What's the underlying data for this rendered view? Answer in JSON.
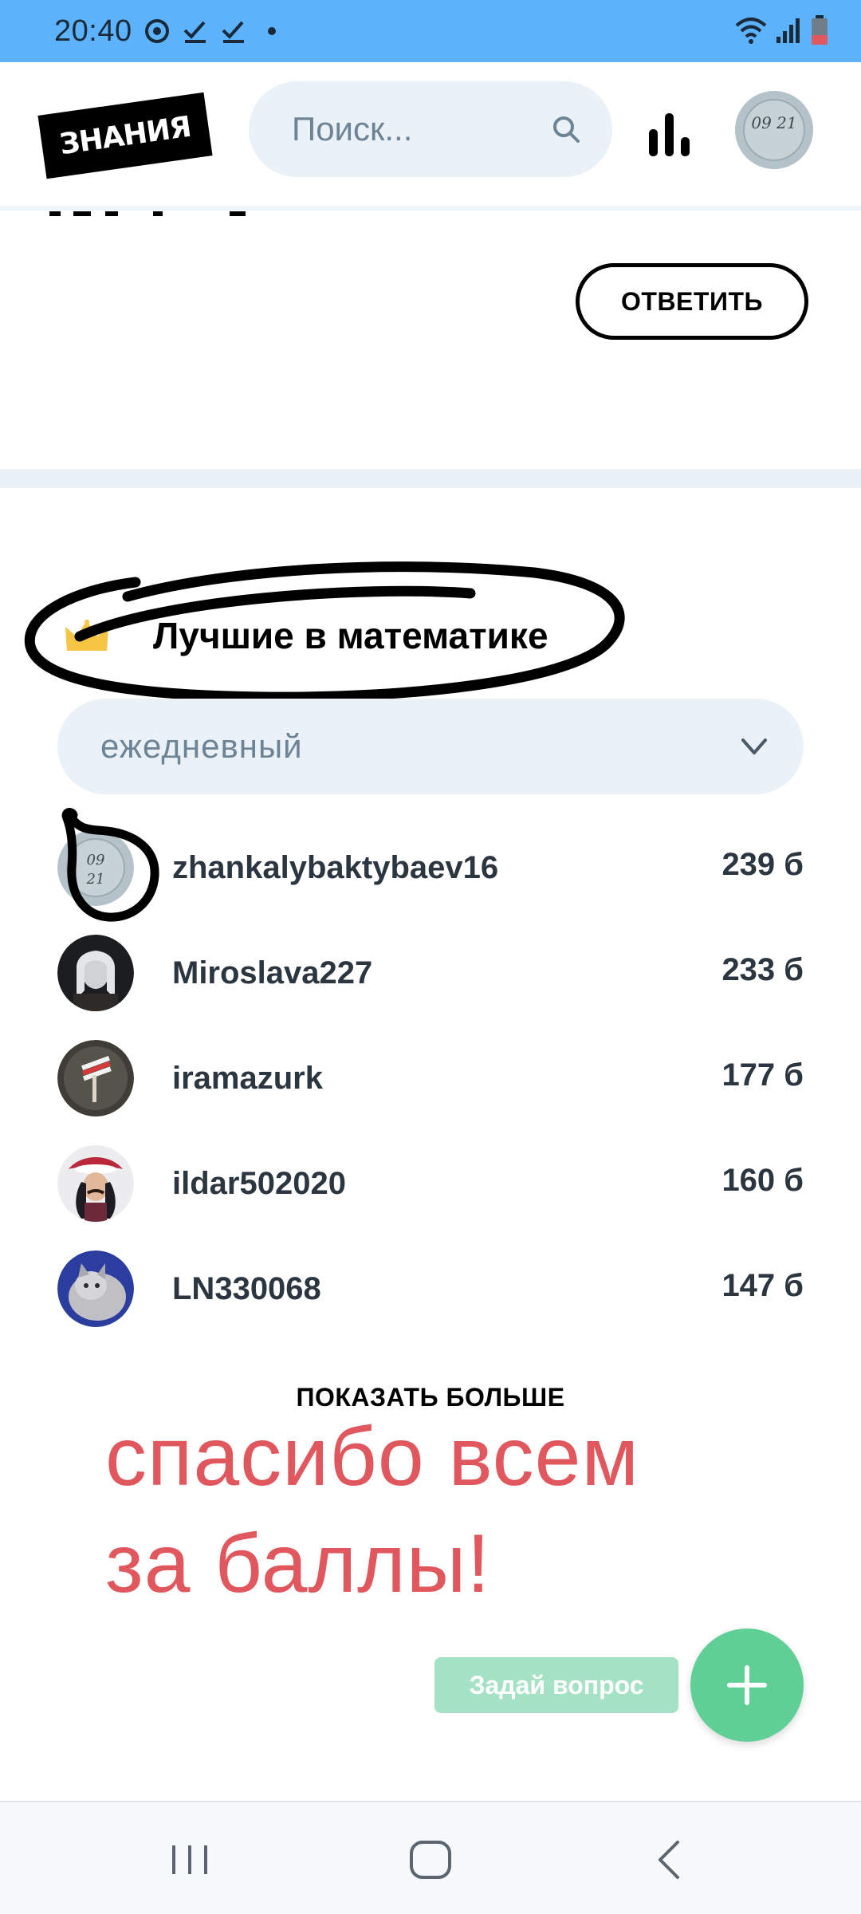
{
  "status_bar": {
    "time": "20:40"
  },
  "header": {
    "logo": "ЗНАНИЯ",
    "search_placeholder": "Поиск...",
    "avatar_text": "09 21"
  },
  "answer": {
    "button_label": "ОТВЕТИТЬ"
  },
  "leaders": {
    "title": "Лучшие в математике",
    "period": "ежедневный",
    "items": [
      {
        "name": "zhankalybaktybaev16",
        "points": "239 б"
      },
      {
        "name": "Miroslava227",
        "points": "233 б"
      },
      {
        "name": "iramazurk",
        "points": "177 б"
      },
      {
        "name": "ildar502020",
        "points": "160 б"
      },
      {
        "name": "LN330068",
        "points": "147 б"
      }
    ],
    "show_more": "ПОКАЗАТЬ БОЛЬШЕ"
  },
  "annotation": {
    "line1": "спасибо всем",
    "line2": "за баллы!"
  },
  "ask": {
    "button_label": "Задай вопрос"
  },
  "colors": {
    "status_bar": "#5cb3fb",
    "accent_green": "#5fcf96",
    "input_bg": "#ebf2f7",
    "annotation_red": "#e0585e"
  },
  "icons": [
    "search-icon",
    "stats-icon",
    "crown-icon",
    "chevron-down-icon",
    "plus-icon",
    "recent-apps-icon",
    "home-icon",
    "back-icon",
    "wifi-icon",
    "signal-icon",
    "battery-icon"
  ]
}
